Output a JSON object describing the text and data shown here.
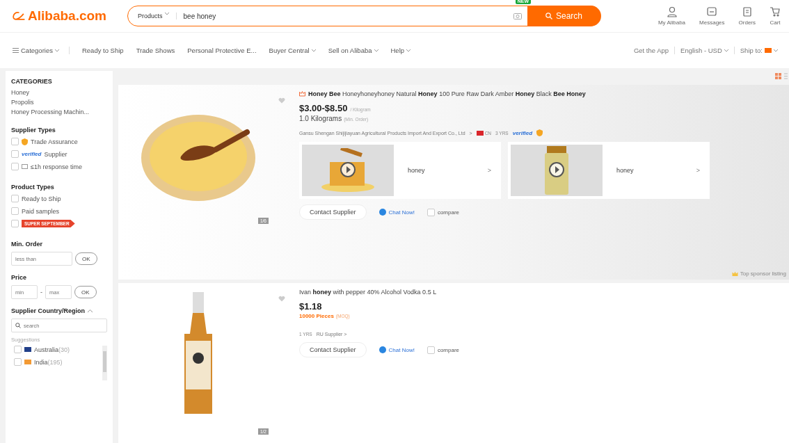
{
  "header": {
    "logo": "Alibaba.com",
    "search": {
      "category": "Products",
      "value": "bee honey",
      "badge": "NEW",
      "button": "Search"
    },
    "actions": [
      {
        "kind": "user",
        "label": "My Alibaba"
      },
      {
        "kind": "message",
        "label": "Messages"
      },
      {
        "kind": "order",
        "label": "Orders"
      },
      {
        "kind": "cart",
        "label": "Cart"
      }
    ]
  },
  "nav": {
    "items": [
      {
        "label": "Categories",
        "kind": "menu",
        "dropdown": true
      },
      {
        "label": "Ready to Ship",
        "kind": "link",
        "dropdown": false
      },
      {
        "label": "Trade Shows",
        "kind": "link",
        "dropdown": false
      },
      {
        "label": "Personal Protective E...",
        "kind": "link",
        "dropdown": false
      },
      {
        "label": "Buyer Central",
        "kind": "link",
        "dropdown": true
      },
      {
        "label": "Sell on Alibaba",
        "kind": "link",
        "dropdown": true
      },
      {
        "label": "Help",
        "kind": "link",
        "dropdown": true
      }
    ],
    "right": [
      {
        "label": "Get the App",
        "dropdown": false
      },
      {
        "label": "English - USD",
        "dropdown": true
      },
      {
        "label": "Ship to:",
        "dropdown": true
      }
    ]
  },
  "sidebar": {
    "categories_title": "CATEGORIES",
    "categories": [
      "Honey",
      "Propolis",
      "Honey Processing Machin..."
    ],
    "supplier_types_title": "Supplier Types",
    "supplier_types": [
      {
        "kind": "trade",
        "label": "Trade Assurance",
        "checked": false
      },
      {
        "kind": "verified",
        "badge": "verified",
        "label": "Supplier",
        "checked": false
      },
      {
        "kind": "response",
        "label": "≤1h response time",
        "checked": false
      }
    ],
    "product_types_title": "Product Types",
    "product_types": [
      {
        "kind": "text",
        "label": "Ready to Ship",
        "checked": false
      },
      {
        "kind": "text",
        "label": "Paid samples",
        "checked": false
      },
      {
        "kind": "tag",
        "label": "SUPER SEPTEMBER",
        "checked": false
      }
    ],
    "min_order": {
      "title": "Min. Order",
      "placeholder": "less than",
      "button": "OK"
    },
    "price": {
      "title": "Price",
      "min_placeholder": "min",
      "separator": "-",
      "max_placeholder": "max",
      "button": "OK"
    },
    "country": {
      "title": "Supplier Country/Region",
      "expanded": true,
      "placeholder": "search",
      "suggestions_title": "Suggestions",
      "items": [
        {
          "name": "Australia",
          "count": "(30)",
          "checked": false
        },
        {
          "name": "India",
          "count": "(195)",
          "checked": false
        }
      ]
    }
  },
  "products": [
    {
      "sponsored": true,
      "title": "**Honey Bee** Honeyhoneyhoney Natural **Honey** 100 Pure Raw Dark Amber **Honey** Black **Bee Honey**",
      "crown": true,
      "price": "$3.00-$8.50",
      "unit": "/ Kilogram",
      "moq": "1.0 Kilograms",
      "moq_note": "(Min. Order)",
      "moq_highlight": false,
      "supplier": "Gansu Shengan Shijijiayuan Agricultural Products Import And Export Co., Ltd",
      "supplier_arrow": ">",
      "country": "CN",
      "years": "3 YRS",
      "verified": "verified",
      "videos": [
        {
          "label": "honey",
          "arrow": ">"
        },
        {
          "label": "honey",
          "arrow": ">"
        }
      ],
      "contact": "Contact Supplier",
      "chat": "Chat Now!",
      "compare": "compare",
      "compare_checked": false,
      "page": "1/6",
      "sponsor": "Top sponsor listing"
    },
    {
      "sponsored": false,
      "title": "Ivan **honey** with pepper 40% Alcohol Vodka 0.5 L",
      "crown": false,
      "price": "$1.18",
      "moq": "10000 Pieces",
      "moq_note": "(MOQ)",
      "moq_highlight": true,
      "years": "1 YRS",
      "supplier": "RU Supplier >",
      "contact": "Contact Supplier",
      "chat": "Chat Now!",
      "compare": "compare",
      "compare_checked": false,
      "page": "1/2"
    }
  ]
}
